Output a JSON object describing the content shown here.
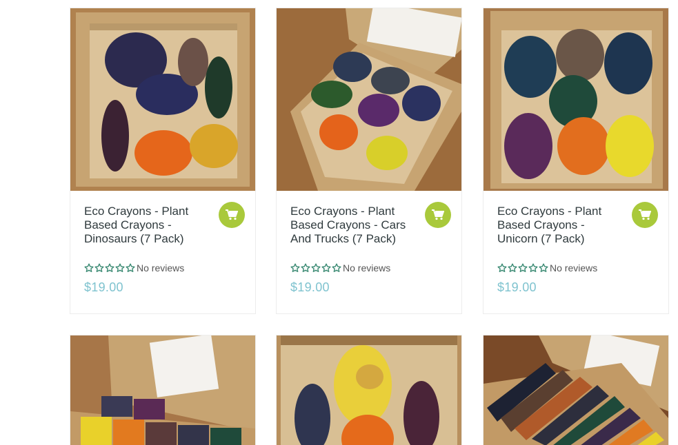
{
  "colors": {
    "cart_button": "#a9c93b",
    "star": "#3b8a73",
    "price": "#7fc3cf",
    "title": "#2f3a3d"
  },
  "cart_icon": "shopping-cart-icon",
  "star_icon": "star-outline-icon",
  "products": [
    {
      "title": "Eco Crayons - Plant Based Crayons - Dinosaurs (7 Pack)",
      "reviews": "No reviews",
      "price": "$19.00",
      "image": "dinosaur-crayons-photo"
    },
    {
      "title": "Eco Crayons - Plant Based Crayons - Cars And Trucks (7 Pack)",
      "reviews": "No reviews",
      "price": "$19.00",
      "image": "cars-trucks-crayons-photo"
    },
    {
      "title": "Eco Crayons - Plant Based Crayons - Unicorn (7 Pack)",
      "reviews": "No reviews",
      "price": "$19.00",
      "image": "unicorn-crayons-photo"
    },
    {
      "image": "block-crayons-photo"
    },
    {
      "image": "easter-crayons-photo"
    },
    {
      "image": "stick-crayons-photo"
    }
  ]
}
